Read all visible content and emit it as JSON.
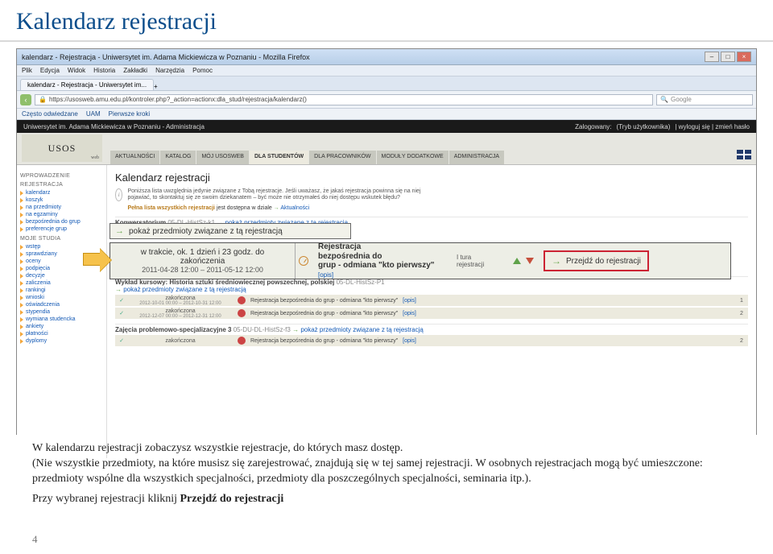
{
  "title": "Kalendarz rejestracji",
  "ff": {
    "wintitle": "kalendarz - Rejestracja - Uniwersytet im. Adama Mickiewicza w Poznaniu - Mozilla Firefox",
    "menus": [
      "Plik",
      "Edycja",
      "Widok",
      "Historia",
      "Zakładki",
      "Narzędzia",
      "Pomoc"
    ],
    "tab": "kalendarz - Rejestracja - Uniwersytet im...",
    "url": "https://usosweb.amu.edu.pl/kontroler.php?_action=actionx:dla_stud/rejestracja/kalendarz()",
    "search_ph": "Google",
    "bookmarks": [
      "Często odwiedzane",
      "UAM",
      "Pierwsze kroki"
    ]
  },
  "uni": {
    "left": "Uniwersytet im. Adama Mickiewicza w Poznaniu - Administracja",
    "zalog": "Zalogowany:",
    "tryb": "(Tryb użytkownika)",
    "links": "| wyloguj się | zmień hasło"
  },
  "logo": {
    "main": "USOS",
    "sub": "web"
  },
  "nav": [
    "AKTUALNOŚCI",
    "KATALOG",
    "MÓJ USOSWEB",
    "DLA STUDENTÓW",
    "DLA PRACOWNIKÓW",
    "MODUŁY DODATKOWE",
    "ADMINISTRACJA"
  ],
  "nav_active": 3,
  "side": {
    "g1": "WPROWADZENIE",
    "g2": "REJESTRACJA",
    "g2i": [
      "kalendarz",
      "koszyk",
      "na przedmioty",
      "na egzaminy",
      "bezpośrednia do grup",
      "preferencje grup"
    ],
    "g3": "MOJE STUDIA",
    "g3i": [
      "wstęp",
      "sprawdziany",
      "oceny",
      "podpięcia",
      "decyzje",
      "zaliczenia",
      "rankingi",
      "wnioski",
      "oświadczenia",
      "stypendia",
      "wymiana studencka",
      "ankiety",
      "płatności",
      "dyplomy"
    ]
  },
  "main": {
    "h2": "Kalendarz rejestracji",
    "info1": "Poniższa lista uwzględnia jedynie związane z Tobą rejestracje. Jeśli uważasz, że jakaś rejestracja powinna się na niej pojawiać, to skontaktuj się ze swoim dziekanatem – być może nie otrzymałeś do niej dostępu wskutek błędu?",
    "info2a": "Pełna lista wszystkich rejestracji",
    "info2b": "jest dostępna w dziale",
    "info2c": "Aktualności",
    "konw": "Konwersatorium",
    "konw_code": "05-DL-HistSz-k1",
    "konw_link": "pokaż przedmioty związane z tą rejestracją",
    "hi1_text": "pokaż przedmioty związane z tą rejestracją",
    "row": {
      "lead": "w trakcie, ok. 1 dzień i 23 godz. do zakończenia",
      "dates": "2011-04-28 12:00 – 2011-05-12 12:00",
      "title1": "Rejestracja",
      "title2": "bezpośrednia do",
      "title3": "grup - odmiana \"kto pierwszy\"",
      "ops": "[opis]",
      "tura": "I tura",
      "rejest": "rejestracji",
      "go": "Przejdź do rejestracji"
    },
    "wk": {
      "title": "Wykład kursowy: Historia sztuki średniowiecznej powszechnej, polskiej",
      "code": "05-DL-HistSz-P1",
      "link": "pokaż przedmioty związane z tą rejestracją"
    },
    "rows": [
      {
        "zak": "zakończona",
        "dates": "2012-10-01 00:00 – 2012-10-31 12:00",
        "desc": "Rejestracja bezpośrednia do grup - odmiana \"kto pierwszy\"",
        "opis": "[opis]",
        "n": "1"
      },
      {
        "zak": "zakończona",
        "dates": "2012-12-07 00:00 – 2012-12-31 12:00",
        "desc": "Rejestracja bezpośrednia do grup - odmiana \"kto pierwszy\"",
        "opis": "[opis]",
        "n": "2"
      }
    ],
    "zaj": {
      "title": "Zajęcia problemowo-specjalizacyjne 3",
      "code": "05-DU-DL-HistSz-f3",
      "link": "pokaż przedmioty związane z tą rejestracją"
    },
    "rows2": [
      {
        "zak": "zakończona",
        "dates": "",
        "desc": "Rejestracja bezpośrednia do grup - odmiana \"kto pierwszy\"",
        "opis": "[opis]",
        "n": "2"
      }
    ]
  },
  "explain": {
    "p1a": "W kalendarzu rejestracji zobaczysz wszystkie rejestracje, do których masz dostęp.",
    "p1b": "(Nie wszystkie przedmioty, na które musisz się zarejestrować, znajdują się w tej samej rejestracji. W osobnych rejestracjach mogą być umieszczone: przedmioty wspólne dla wszystkich specjalności, przedmioty dla poszczególnych specjalności, seminaria itp.).",
    "p2a": "Przy wybranej rejestracji kliknij ",
    "p2b": "Przejdź do rejestracji"
  },
  "page_num": "4"
}
